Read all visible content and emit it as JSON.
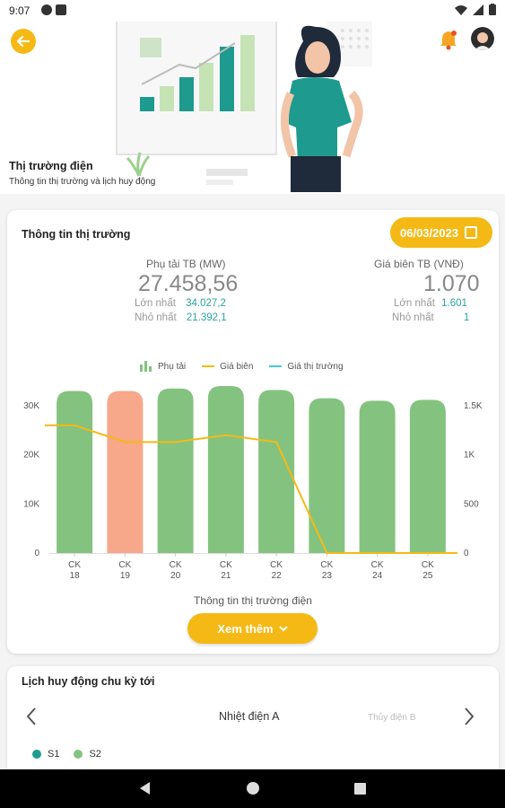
{
  "status_bar": {
    "time": "9:07"
  },
  "hero": {
    "title": "Thị trường điện",
    "subtitle": "Thông tin thị trường và lịch huy động"
  },
  "market": {
    "title": "Thông tin thị trường",
    "date": "06/03/2023",
    "load": {
      "label": "Phụ tải TB (MW)",
      "value": "27.458,56",
      "max_label": "Lớn nhất",
      "max_value": "34.027,2",
      "min_label": "Nhỏ nhất",
      "min_value": "21.392,1"
    },
    "price": {
      "label": "Giá biên TB (VNĐ)",
      "value": "1.070",
      "max_label": "Lớn nhất",
      "max_value": "1.601",
      "min_label": "Nhỏ nhất",
      "min_value": "1"
    },
    "legend": {
      "load": "Phụ tải",
      "marginal": "Giá biên",
      "market": "Giá thị trường"
    },
    "caption": "Thông tin thị trường điện",
    "more_button": "Xem thêm"
  },
  "chart_data": {
    "type": "bar",
    "categories": [
      "CK 18",
      "CK 19",
      "CK 20",
      "CK 21",
      "CK 22",
      "CK 23",
      "CK 24",
      "CK 25"
    ],
    "category_lines": [
      [
        "CK",
        "18"
      ],
      [
        "CK",
        "19"
      ],
      [
        "CK",
        "20"
      ],
      [
        "CK",
        "21"
      ],
      [
        "CK",
        "22"
      ],
      [
        "CK",
        "23"
      ],
      [
        "CK",
        "24"
      ],
      [
        "CK",
        "25"
      ]
    ],
    "series": [
      {
        "name": "Phụ tải",
        "axis": "left",
        "type": "bar",
        "values": [
          33000,
          33000,
          33500,
          34000,
          33200,
          31500,
          31000,
          31200
        ],
        "colors": [
          "#84c37f",
          "#f7a78a",
          "#84c37f",
          "#84c37f",
          "#84c37f",
          "#84c37f",
          "#84c37f",
          "#84c37f"
        ]
      },
      {
        "name": "Giá biên",
        "axis": "right",
        "type": "line",
        "color": "#f5b916",
        "values": [
          1300,
          1130,
          1130,
          1200,
          1130,
          0,
          0,
          0
        ]
      },
      {
        "name": "Giá thị trường",
        "axis": "right",
        "type": "line",
        "color": "#47c9dd",
        "values": []
      }
    ],
    "y_left": {
      "ticks": [
        0,
        10000,
        20000,
        30000
      ],
      "tick_labels": [
        "0",
        "10K",
        "20K",
        "30K"
      ],
      "lim": [
        0,
        34000
      ]
    },
    "y_right": {
      "ticks": [
        0,
        500,
        1000,
        1500
      ],
      "tick_labels": [
        "0",
        "500",
        "1K",
        "1.5K"
      ],
      "lim": [
        0,
        1700
      ]
    },
    "grid": false,
    "legend_position": "top"
  },
  "schedule": {
    "title": "Lịch huy động chu kỳ tới",
    "tab_active": "Nhiệt điện A",
    "tab_inactive": "Thủy điện B",
    "legend": [
      {
        "label": "S1",
        "color": "#1e9a8f"
      },
      {
        "label": "S2",
        "color": "#84c37f"
      }
    ]
  }
}
